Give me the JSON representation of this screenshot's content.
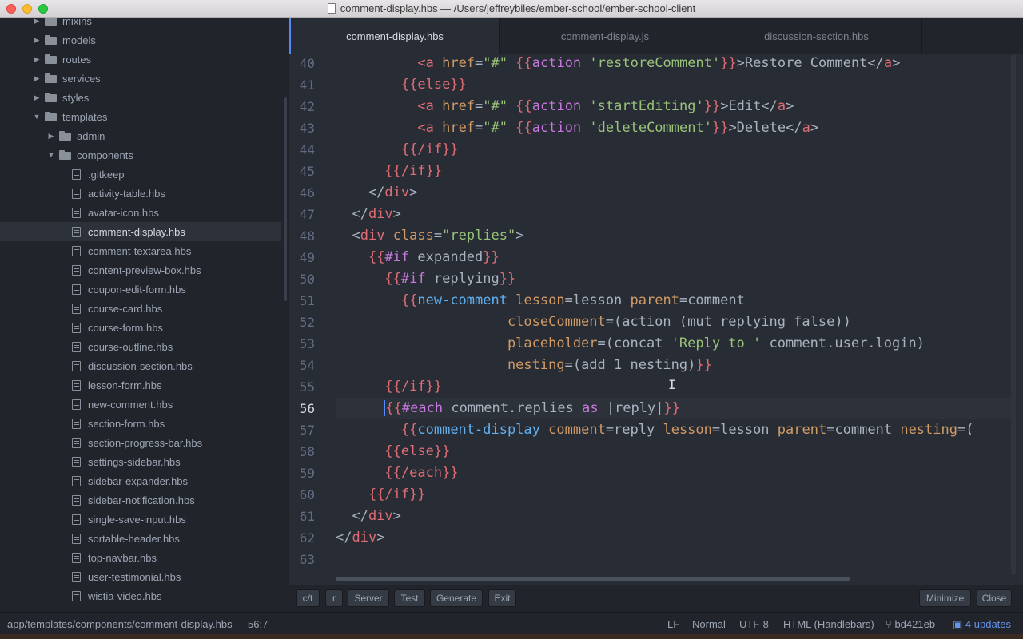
{
  "window": {
    "title": "comment-display.hbs — /Users/jeffreybiles/ember-school/ember-school-client"
  },
  "sidebar": {
    "items": [
      {
        "label": "mixins",
        "kind": "folder",
        "state": "collapsed",
        "depth": 1
      },
      {
        "label": "models",
        "kind": "folder",
        "state": "collapsed",
        "depth": 1
      },
      {
        "label": "routes",
        "kind": "folder",
        "state": "collapsed",
        "depth": 1
      },
      {
        "label": "services",
        "kind": "folder",
        "state": "collapsed",
        "depth": 1
      },
      {
        "label": "styles",
        "kind": "folder",
        "state": "collapsed",
        "depth": 1
      },
      {
        "label": "templates",
        "kind": "folder",
        "state": "expanded",
        "depth": 1
      },
      {
        "label": "admin",
        "kind": "folder",
        "state": "collapsed",
        "depth": 2
      },
      {
        "label": "components",
        "kind": "folder",
        "state": "expanded",
        "depth": 2
      },
      {
        "label": ".gitkeep",
        "kind": "file",
        "depth": 3
      },
      {
        "label": "activity-table.hbs",
        "kind": "file",
        "depth": 3
      },
      {
        "label": "avatar-icon.hbs",
        "kind": "file",
        "depth": 3
      },
      {
        "label": "comment-display.hbs",
        "kind": "file",
        "depth": 3,
        "selected": true
      },
      {
        "label": "comment-textarea.hbs",
        "kind": "file",
        "depth": 3
      },
      {
        "label": "content-preview-box.hbs",
        "kind": "file",
        "depth": 3
      },
      {
        "label": "coupon-edit-form.hbs",
        "kind": "file",
        "depth": 3
      },
      {
        "label": "course-card.hbs",
        "kind": "file",
        "depth": 3
      },
      {
        "label": "course-form.hbs",
        "kind": "file",
        "depth": 3
      },
      {
        "label": "course-outline.hbs",
        "kind": "file",
        "depth": 3
      },
      {
        "label": "discussion-section.hbs",
        "kind": "file",
        "depth": 3
      },
      {
        "label": "lesson-form.hbs",
        "kind": "file",
        "depth": 3
      },
      {
        "label": "new-comment.hbs",
        "kind": "file",
        "depth": 3
      },
      {
        "label": "section-form.hbs",
        "kind": "file",
        "depth": 3
      },
      {
        "label": "section-progress-bar.hbs",
        "kind": "file",
        "depth": 3
      },
      {
        "label": "settings-sidebar.hbs",
        "kind": "file",
        "depth": 3
      },
      {
        "label": "sidebar-expander.hbs",
        "kind": "file",
        "depth": 3
      },
      {
        "label": "sidebar-notification.hbs",
        "kind": "file",
        "depth": 3
      },
      {
        "label": "single-save-input.hbs",
        "kind": "file",
        "depth": 3
      },
      {
        "label": "sortable-header.hbs",
        "kind": "file",
        "depth": 3
      },
      {
        "label": "top-navbar.hbs",
        "kind": "file",
        "depth": 3
      },
      {
        "label": "user-testimonial.hbs",
        "kind": "file",
        "depth": 3
      },
      {
        "label": "wistia-video.hbs",
        "kind": "file",
        "depth": 3
      }
    ]
  },
  "tabs": [
    {
      "label": "comment-display.hbs",
      "active": true
    },
    {
      "label": "comment-display.js",
      "active": false
    },
    {
      "label": "discussion-section.hbs",
      "active": false
    }
  ],
  "editor": {
    "current_line": "56",
    "lines": [
      {
        "num": "40",
        "tokens": [
          [
            "txt",
            "          "
          ],
          [
            "tag",
            "<a"
          ],
          [
            "txt",
            " "
          ],
          [
            "attr",
            "href"
          ],
          [
            "txt",
            "="
          ],
          [
            "str",
            "\"#\""
          ],
          [
            "txt",
            " "
          ],
          [
            "hb",
            "{{"
          ],
          [
            "kw",
            "action"
          ],
          [
            "txt",
            " "
          ],
          [
            "str",
            "'restoreComment'"
          ],
          [
            "hb",
            "}}"
          ],
          [
            "txt",
            ">Restore Comment</"
          ],
          [
            "tag",
            "a"
          ],
          [
            "txt",
            ">"
          ]
        ]
      },
      {
        "num": "41",
        "tokens": [
          [
            "txt",
            "        "
          ],
          [
            "hb",
            "{{else}}"
          ]
        ]
      },
      {
        "num": "42",
        "tokens": [
          [
            "txt",
            "          "
          ],
          [
            "tag",
            "<a"
          ],
          [
            "txt",
            " "
          ],
          [
            "attr",
            "href"
          ],
          [
            "txt",
            "="
          ],
          [
            "str",
            "\"#\""
          ],
          [
            "txt",
            " "
          ],
          [
            "hb",
            "{{"
          ],
          [
            "kw",
            "action"
          ],
          [
            "txt",
            " "
          ],
          [
            "str",
            "'startEditing'"
          ],
          [
            "hb",
            "}}"
          ],
          [
            "txt",
            ">Edit</"
          ],
          [
            "tag",
            "a"
          ],
          [
            "txt",
            ">"
          ]
        ]
      },
      {
        "num": "43",
        "tokens": [
          [
            "txt",
            "          "
          ],
          [
            "tag",
            "<a"
          ],
          [
            "txt",
            " "
          ],
          [
            "attr",
            "href"
          ],
          [
            "txt",
            "="
          ],
          [
            "str",
            "\"#\""
          ],
          [
            "txt",
            " "
          ],
          [
            "hb",
            "{{"
          ],
          [
            "kw",
            "action"
          ],
          [
            "txt",
            " "
          ],
          [
            "str",
            "'deleteComment'"
          ],
          [
            "hb",
            "}}"
          ],
          [
            "txt",
            ">Delete</"
          ],
          [
            "tag",
            "a"
          ],
          [
            "txt",
            ">"
          ]
        ]
      },
      {
        "num": "44",
        "tokens": [
          [
            "txt",
            "        "
          ],
          [
            "hb",
            "{{/if}}"
          ]
        ]
      },
      {
        "num": "45",
        "tokens": [
          [
            "txt",
            "      "
          ],
          [
            "hb",
            "{{/if}}"
          ]
        ]
      },
      {
        "num": "46",
        "tokens": [
          [
            "txt",
            "    </"
          ],
          [
            "tag",
            "div"
          ],
          [
            "txt",
            ">"
          ]
        ]
      },
      {
        "num": "47",
        "tokens": [
          [
            "txt",
            "  </"
          ],
          [
            "tag",
            "div"
          ],
          [
            "txt",
            ">"
          ]
        ]
      },
      {
        "num": "48",
        "tokens": [
          [
            "txt",
            "  <"
          ],
          [
            "tag",
            "div"
          ],
          [
            "txt",
            " "
          ],
          [
            "attr",
            "class"
          ],
          [
            "txt",
            "="
          ],
          [
            "str",
            "\"replies\""
          ],
          [
            "txt",
            ">"
          ]
        ]
      },
      {
        "num": "49",
        "tokens": [
          [
            "txt",
            "    "
          ],
          [
            "hb",
            "{{"
          ],
          [
            "kw",
            "#if"
          ],
          [
            "txt",
            " expanded"
          ],
          [
            "hb",
            "}}"
          ]
        ]
      },
      {
        "num": "50",
        "tokens": [
          [
            "txt",
            "      "
          ],
          [
            "hb",
            "{{"
          ],
          [
            "kw",
            "#if"
          ],
          [
            "txt",
            " replying"
          ],
          [
            "hb",
            "}}"
          ]
        ]
      },
      {
        "num": "51",
        "tokens": [
          [
            "txt",
            "        "
          ],
          [
            "hb",
            "{{"
          ],
          [
            "fn",
            "new-comment"
          ],
          [
            "txt",
            " "
          ],
          [
            "attr",
            "lesson"
          ],
          [
            "txt",
            "=lesson "
          ],
          [
            "attr",
            "parent"
          ],
          [
            "txt",
            "=comment"
          ]
        ]
      },
      {
        "num": "52",
        "tokens": [
          [
            "txt",
            "                     "
          ],
          [
            "attr",
            "closeComment"
          ],
          [
            "txt",
            "=(action (mut replying false))"
          ]
        ]
      },
      {
        "num": "53",
        "tokens": [
          [
            "txt",
            "                     "
          ],
          [
            "attr",
            "placeholder"
          ],
          [
            "txt",
            "=(concat "
          ],
          [
            "str",
            "'Reply to '"
          ],
          [
            "txt",
            " comment.user.login)"
          ]
        ]
      },
      {
        "num": "54",
        "tokens": [
          [
            "txt",
            "                     "
          ],
          [
            "attr",
            "nesting"
          ],
          [
            "txt",
            "=(add 1 nesting)"
          ],
          [
            "hb",
            "}}"
          ]
        ]
      },
      {
        "num": "55",
        "tokens": [
          [
            "txt",
            "      "
          ],
          [
            "hb",
            "{{/if}}"
          ]
        ]
      },
      {
        "num": "56",
        "tokens": [
          [
            "txt",
            "      "
          ],
          [
            "cursor",
            ""
          ],
          [
            "hb",
            "{{"
          ],
          [
            "kw",
            "#each"
          ],
          [
            "txt",
            " comment.replies "
          ],
          [
            "kw",
            "as"
          ],
          [
            "txt",
            " |reply|"
          ],
          [
            "hb",
            "}}"
          ]
        ]
      },
      {
        "num": "57",
        "tokens": [
          [
            "txt",
            "        "
          ],
          [
            "hb",
            "{{"
          ],
          [
            "fn",
            "comment-display"
          ],
          [
            "txt",
            " "
          ],
          [
            "attr",
            "comment"
          ],
          [
            "txt",
            "=reply "
          ],
          [
            "attr",
            "lesson"
          ],
          [
            "txt",
            "=lesson "
          ],
          [
            "attr",
            "parent"
          ],
          [
            "txt",
            "=comment "
          ],
          [
            "attr",
            "nesting"
          ],
          [
            "txt",
            "=("
          ]
        ]
      },
      {
        "num": "58",
        "tokens": [
          [
            "txt",
            "      "
          ],
          [
            "hb",
            "{{else}}"
          ]
        ]
      },
      {
        "num": "59",
        "tokens": [
          [
            "txt",
            "      "
          ],
          [
            "hb",
            "{{/each}}"
          ]
        ]
      },
      {
        "num": "60",
        "tokens": [
          [
            "txt",
            "    "
          ],
          [
            "hb",
            "{{/if}}"
          ]
        ]
      },
      {
        "num": "61",
        "tokens": [
          [
            "txt",
            "  </"
          ],
          [
            "tag",
            "div"
          ],
          [
            "txt",
            ">"
          ]
        ]
      },
      {
        "num": "62",
        "tokens": [
          [
            "txt",
            "</"
          ],
          [
            "tag",
            "div"
          ],
          [
            "txt",
            ">"
          ]
        ]
      },
      {
        "num": "63",
        "tokens": []
      }
    ]
  },
  "toolbar": {
    "left_buttons": [
      "c/t",
      "r",
      "Server",
      "Test",
      "Generate",
      "Exit"
    ],
    "right_buttons": [
      "Minimize",
      "Close"
    ]
  },
  "status": {
    "path": "app/templates/components/comment-display.hbs",
    "cursor_pos": "56:7",
    "line_ending": "LF",
    "mode": "Normal",
    "encoding": "UTF-8",
    "grammar": "HTML (Handlebars)",
    "branch": "bd421eb",
    "updates": "4 updates"
  },
  "colors": {
    "accent": "#568af2",
    "tag": "#e06c75",
    "attr": "#d19a66",
    "string": "#98c379",
    "keyword": "#c678dd",
    "function": "#61afef"
  }
}
